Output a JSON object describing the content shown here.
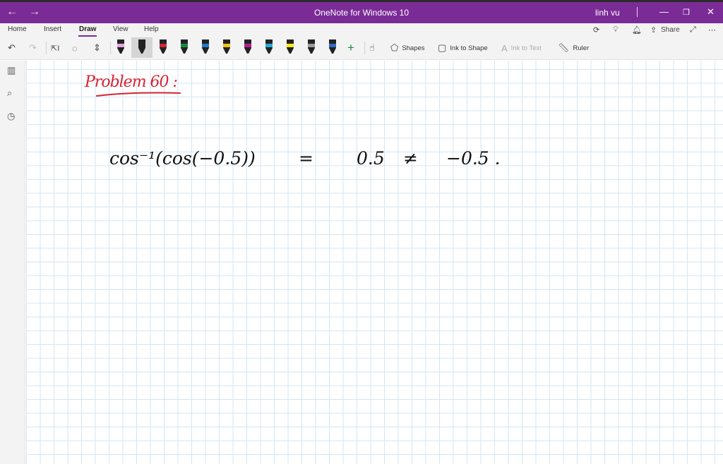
{
  "window": {
    "title": "OneNote for Windows 10",
    "user": "linh vu"
  },
  "ribbon": {
    "tabs": [
      "Home",
      "Insert",
      "Draw",
      "View",
      "Help"
    ],
    "active_tab": "Draw",
    "share_label": "Share",
    "tools": {
      "shapes_label": "Shapes",
      "ink_to_shape_label": "Ink to Shape",
      "ink_to_text_label": "Ink to Text",
      "ruler_label": "Ruler"
    },
    "pens": [
      {
        "color": "#222222",
        "tip": "#e6a3e0"
      },
      {
        "color": "#222222",
        "tip": "#222222"
      },
      {
        "color": "#222222",
        "tip": "#d42432"
      },
      {
        "color": "#222222",
        "tip": "#1a8a3a"
      },
      {
        "color": "#222222",
        "tip": "#2279c8"
      },
      {
        "color": "#222222",
        "tip": "#f0c419"
      },
      {
        "color": "#222222",
        "tip": "#b41e8e"
      },
      {
        "color": "#222222",
        "tip": "#2aa8d8"
      },
      {
        "color": "#222222",
        "tip": "#f3e81a"
      },
      {
        "color": "#222222",
        "tip": "#9b9b9b"
      },
      {
        "color": "#222222",
        "tip": "#2b6cc4"
      }
    ]
  },
  "page": {
    "heading": "Problem 60 :",
    "equation": {
      "lhs": "cos⁻¹(cos(−0.5))",
      "equals": "=",
      "value": "0.5",
      "neq": "≠",
      "rhs": "−0.5 ."
    }
  },
  "colors": {
    "accent": "#7b2b96",
    "heading_ink": "#d42432",
    "grid": "#d3e6f4"
  }
}
